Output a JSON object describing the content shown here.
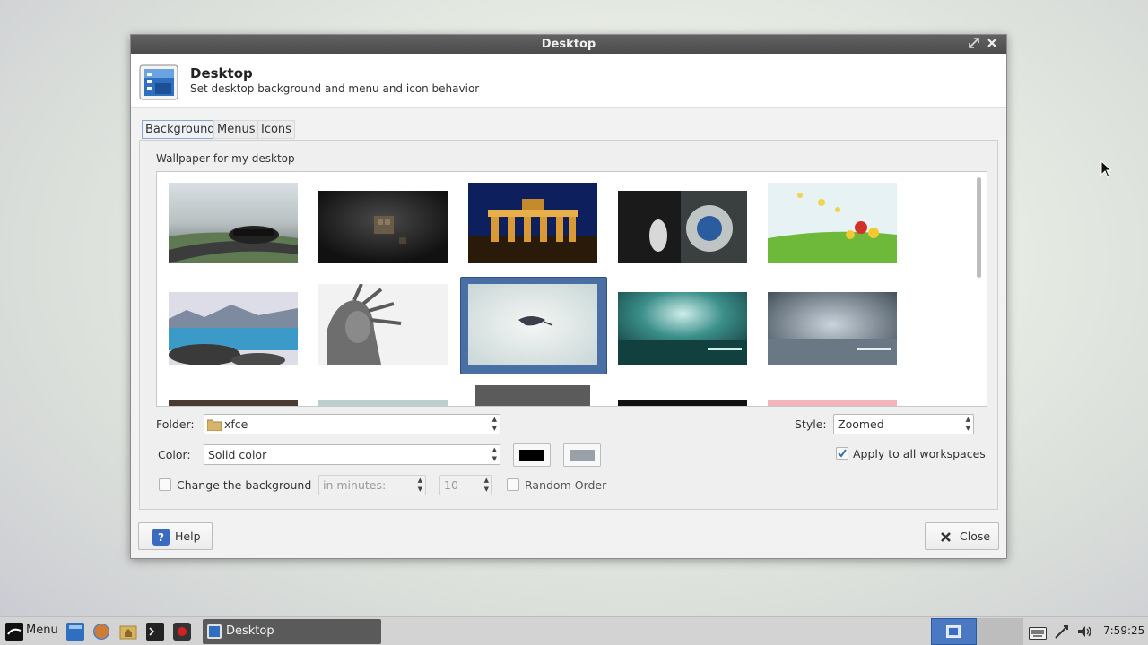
{
  "window": {
    "title": "Desktop",
    "header_title": "Desktop",
    "header_subtitle": "Set desktop background and menu and icon behavior"
  },
  "tabs": [
    {
      "label": "Background",
      "active": true
    },
    {
      "label": "Menus",
      "active": false
    },
    {
      "label": "Icons",
      "active": false
    }
  ],
  "background": {
    "wallpaper_label": "Wallpaper for my desktop",
    "folder_label": "Folder:",
    "folder_value": "xfce",
    "style_label": "Style:",
    "style_value": "Zoomed",
    "color_label": "Color:",
    "color_value": "Solid color",
    "primary_color": "#000000",
    "secondary_color": "#9aa0a8",
    "apply_all_label": "Apply to all workspaces",
    "apply_all_checked": true,
    "change_bg_label": "Change the background",
    "change_bg_checked": false,
    "interval_unit": "in minutes:",
    "interval_value": "10",
    "random_order_label": "Random Order",
    "random_order_checked": false,
    "selected_thumbnail": "feather"
  },
  "buttons": {
    "help": "Help",
    "close": "Close"
  },
  "taskbar": {
    "menu_label": "Menu",
    "task_label": "Desktop",
    "clock": "7:59:25"
  }
}
